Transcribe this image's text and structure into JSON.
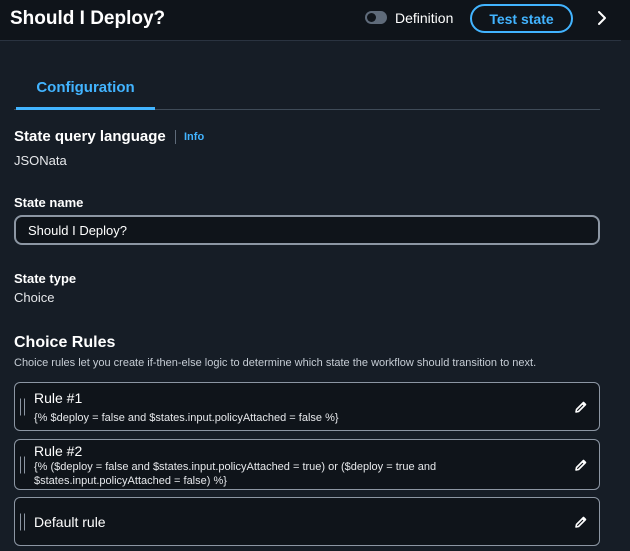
{
  "header": {
    "title": "Should I Deploy?",
    "definition_toggle": {
      "label": "Definition",
      "checked": false
    },
    "test_state_label": "Test state",
    "expand_icon": "chevron-right-icon"
  },
  "tabs": [
    {
      "label": "Configuration",
      "active": true
    }
  ],
  "query_language": {
    "label": "State query language",
    "info_label": "Info",
    "value": "JSONata"
  },
  "state_name": {
    "label": "State name",
    "value": "Should I Deploy?"
  },
  "state_type": {
    "label": "State type",
    "value": "Choice"
  },
  "choice_rules": {
    "title": "Choice Rules",
    "description": "Choice rules let you create if-then-else logic to determine which state the workflow should transition to next.",
    "rules": [
      {
        "title": "Rule #1",
        "condition": "{% $deploy = false and $states.input.policyAttached = false %}"
      },
      {
        "title": "Rule #2",
        "condition": "{% ($deploy = false and $states.input.policyAttached = true) or ($deploy = true and $states.input.policyAttached = false) %}"
      },
      {
        "title": "Default rule",
        "condition": ""
      }
    ]
  },
  "colors": {
    "accent": "#42b4ff",
    "background": "#0f141a",
    "panel": "#161d26"
  }
}
